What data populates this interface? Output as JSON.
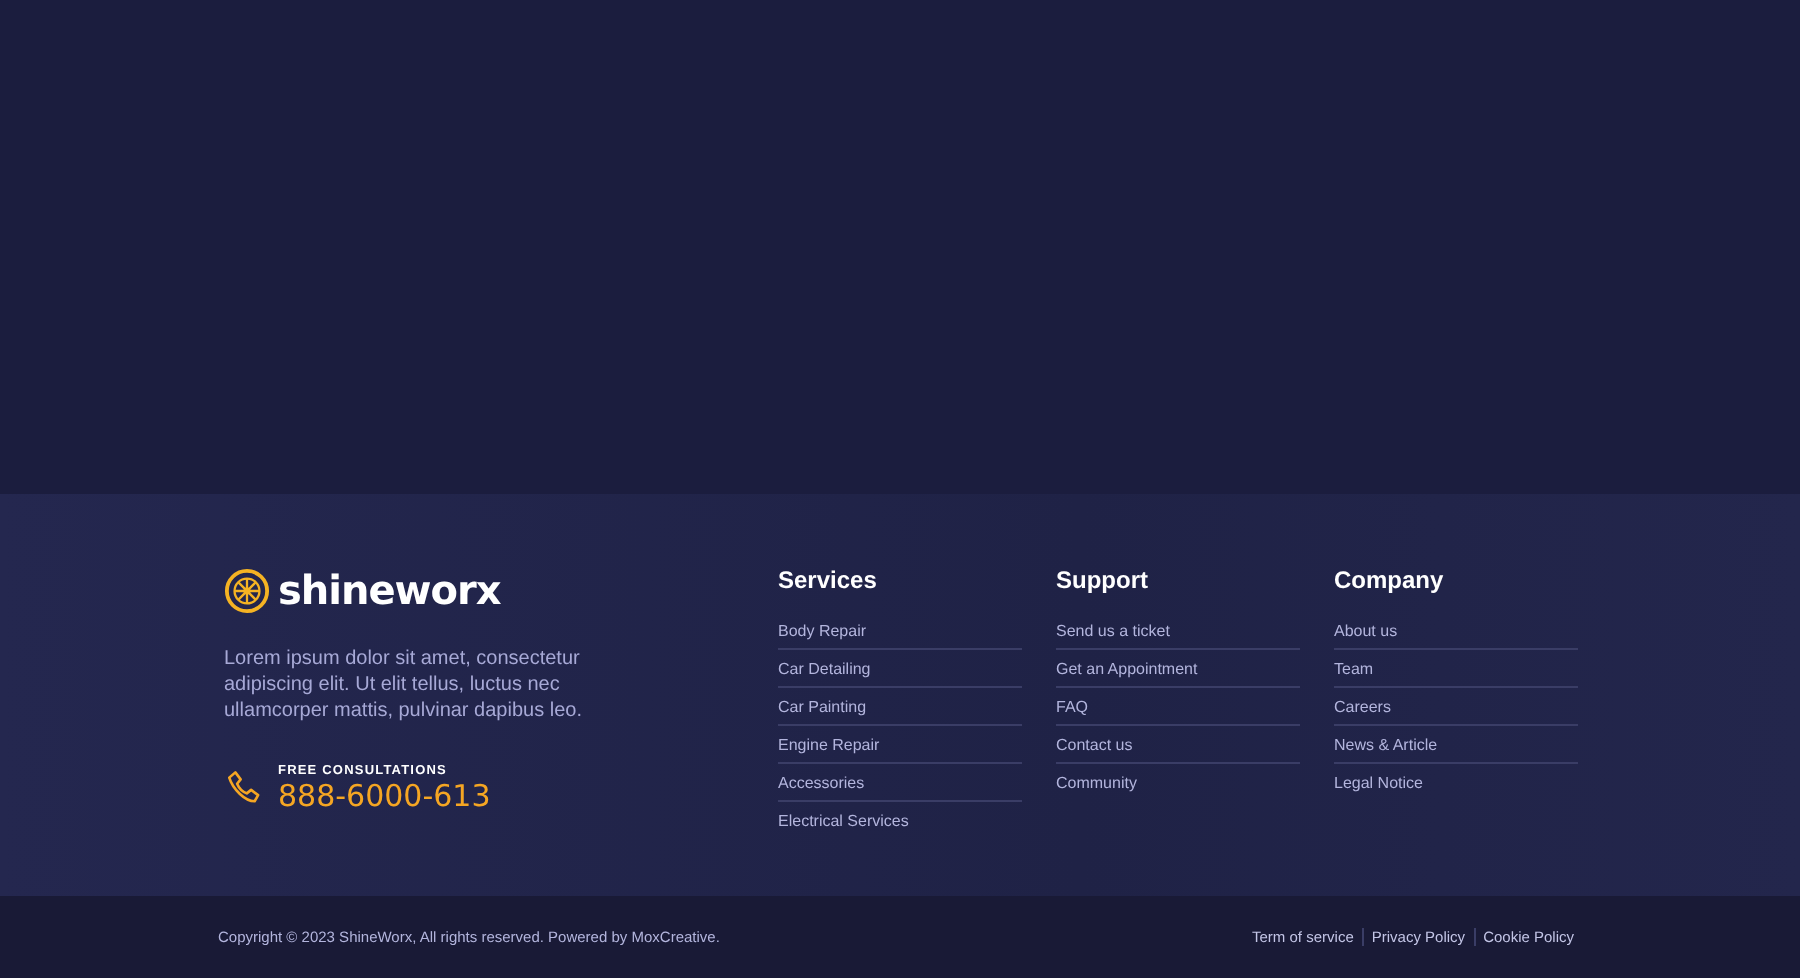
{
  "brand": {
    "name": "shineworx"
  },
  "about": "Lorem ipsum dolor sit amet, consectetur adipiscing elit. Ut elit tellus, luctus nec ullamcorper mattis, pulvinar dapibus leo.",
  "consultation": {
    "label": "FREE CONSULTATIONS",
    "phone": "888-6000-613"
  },
  "columns": [
    {
      "title": "Services",
      "links": [
        "Body Repair",
        "Car Detailing",
        "Car Painting",
        "Engine Repair",
        "Accessories",
        "Electrical Services"
      ]
    },
    {
      "title": "Support",
      "links": [
        "Send us a ticket",
        "Get an Appointment",
        "FAQ",
        "Contact us",
        "Community"
      ]
    },
    {
      "title": "Company",
      "links": [
        "About us",
        "Team",
        "Careers",
        "News & Article",
        "Legal Notice"
      ]
    }
  ],
  "copyright": "Copyright © 2023 ShineWorx, All rights reserved. Powered by MoxCreative.",
  "legal_links": [
    "Term of service",
    "Privacy Policy",
    "Cookie Policy"
  ]
}
